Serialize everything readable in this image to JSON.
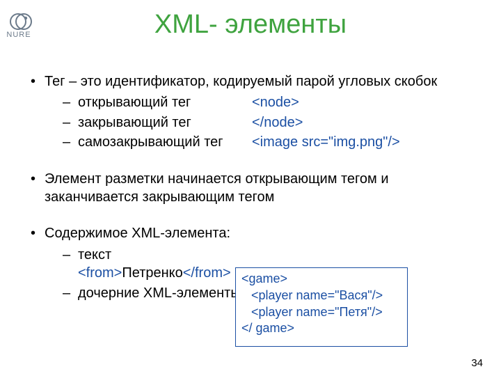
{
  "logo_text": "NURE",
  "title": "XML- элементы",
  "b1": {
    "i0": "Тег –  это идентификатор, кодируемый парой угловых скобок",
    "i1": "Элемент разметки начинается открывающим тегом и заканчивается закрывающим тегом",
    "i2": "Содержимое XML-элемента:"
  },
  "tags": {
    "open_l": "открывающий тег",
    "open_c": "<node>",
    "close_l": "закрывающий тег",
    "close_c": "</node>",
    "self_l": "самозакрывающий тег",
    "self_c": "<image src=\"img.png\"/>"
  },
  "content_sub": {
    "text_l": "текст",
    "text_ex_open": "<from>",
    "text_ex_mid": "Петренко",
    "text_ex_close": "</from>",
    "child_l": "дочерние XML-элементы"
  },
  "box": {
    "l0": "<game>",
    "l1": "<player name=\"Вася\"/>",
    "l2": "<player name=\"Петя\"/>",
    "l3": "</ game>"
  },
  "pagenum": "34"
}
